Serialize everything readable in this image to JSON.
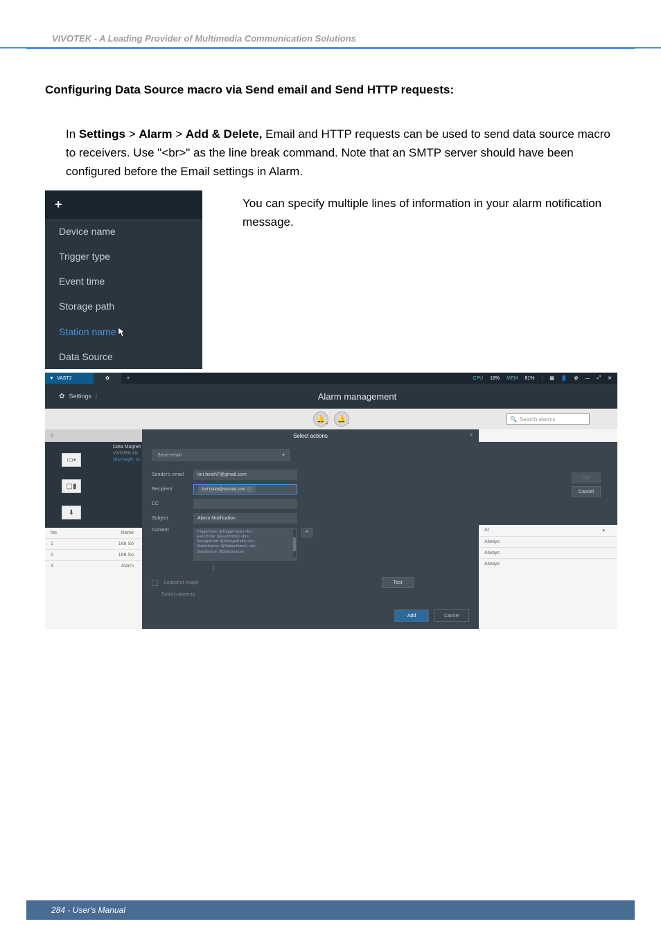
{
  "header": "VIVOTEK - A Leading Provider of Multimedia Communication Solutions",
  "section_title": "Configuring Data Source macro via Send email and Send HTTP requests",
  "colon": ":",
  "body_p1_pre": "In ",
  "body_p1_b1": "Settings",
  "body_p1_gt1": " > ",
  "body_p1_b2": "Alarm",
  "body_p1_gt2": " > ",
  "body_p1_b3": "Add & Delete,",
  "body_p1_post": " Email and HTTP requests can be used to send data source macro to receivers. Use \"<br>\" as the line break command. Note that an SMTP server should have been configured before the Email settings in Alarm.",
  "floating_text": "You can specify multiple lines of information in your alarm notification message.",
  "macro": {
    "plus": "+",
    "items": [
      "Device name",
      "Trigger type",
      "Event time",
      "Storage path",
      "Station name",
      "Data Source"
    ],
    "highlight_index": 4
  },
  "app": {
    "tab1": "VAST2",
    "tab2_icon": "✿",
    "tab3": "+",
    "stats": {
      "cpu_label": "CPU",
      "cpu": "18%",
      "mem_label": "MEM",
      "mem": "81%"
    },
    "right_icons": [
      "▦",
      "👤",
      "✿",
      "—",
      "⤢",
      "✕"
    ]
  },
  "settings": {
    "icon": "✿",
    "label": "Settings",
    "sep": "|",
    "title": "Alarm management"
  },
  "controls": {
    "bell": "🔔",
    "plus": "+",
    "minus": "-",
    "search_icon": "🔍",
    "search_placeholder": "Search alarms"
  },
  "left": {
    "if_label": "If",
    "icons": [
      "▭▪",
      "▢▮",
      "⬇"
    ],
    "table": {
      "headers": {
        "no": "No.",
        "name": "Name"
      },
      "rows": [
        {
          "no": "1",
          "name": "168 So"
        },
        {
          "no": "2",
          "name": "168 So"
        },
        {
          "no": "3",
          "name": "Alarm"
        }
      ]
    }
  },
  "dialog": {
    "header": "Select actions",
    "close": "×",
    "overlap_title": "Data Magnet",
    "overlap_sub": "VIVOTEK AN",
    "overlap_sub2": "char height, po",
    "action_select": {
      "value": "Send email",
      "caret": "▾"
    },
    "fields": {
      "sender_label": "Sender's email",
      "sender_value": "lori.hsieh7@gmail.com",
      "recipient_label": "Recipient",
      "recipient_value": "lori.hsieh@vivotek.com",
      "recipient_x": "ⓧ",
      "cc_label": "CC",
      "cc_value": "",
      "subject_label": "Subject",
      "subject_value": "Alarm Notification",
      "content_label": "Content",
      "content_lines": [
        "TriggerType: $(TriggerType) <br>",
        "EventTime: $(EventTime) <br>",
        "StoragePath: $(StoragePath) <br>",
        "StationName: $(StationName) <br>",
        "DataSource: $(DataSource)"
      ],
      "content_plus": "+",
      "text_cursor": "I"
    },
    "snapshot_label": "Snapshot image",
    "test": "Test",
    "select_cameras": "Select cameras",
    "add": "Add",
    "cancel": "Cancel"
  },
  "right": {
    "ok": "OK",
    "cancel": "Cancel",
    "th_at": "At",
    "always": "Always",
    "caret": "▾"
  },
  "footer": "284 - User's Manual"
}
